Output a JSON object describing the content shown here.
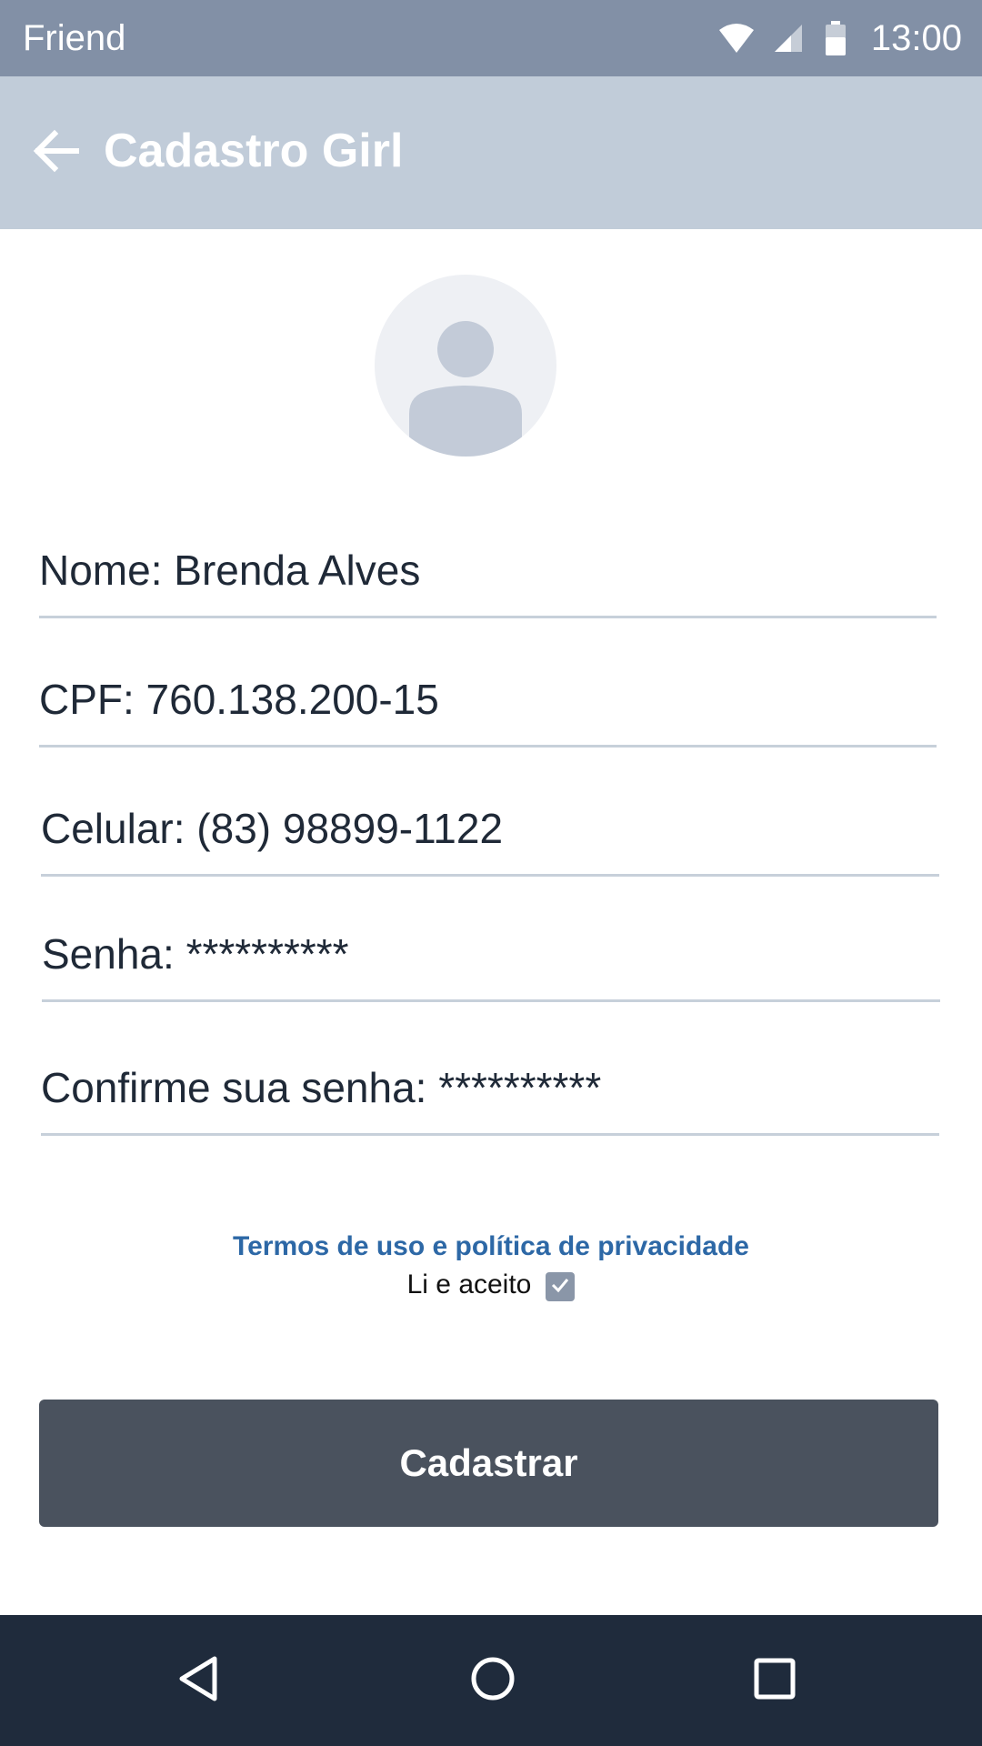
{
  "status_bar": {
    "carrier": "Friend",
    "time": "13:00",
    "icons": [
      "wifi-icon",
      "signal-icon",
      "battery-icon"
    ]
  },
  "app_bar": {
    "title": "Cadastro Girl",
    "back_icon": "arrow-left-icon"
  },
  "avatar": {
    "icon": "person-placeholder-icon"
  },
  "form": {
    "name": "Nome: Brenda Alves",
    "cpf": "CPF: 760.138.200-15",
    "phone": "Celular: (83) 98899-1122",
    "password": "Senha: **********",
    "confirm_password": "Confirme sua senha: **********"
  },
  "terms": {
    "link": "Termos de uso e política de privacidade",
    "accept_label": "Li e aceito",
    "accepted": true
  },
  "submit": {
    "label": "Cadastrar"
  },
  "nav_bar": {
    "icons": [
      "back-triangle-icon",
      "home-circle-icon",
      "recents-square-icon"
    ]
  },
  "colors": {
    "status_bar": "#8290a6",
    "app_bar": "#c1ccd9",
    "link": "#2d68a6",
    "button": "#4a525e",
    "nav_bar": "#1f2b3c"
  }
}
